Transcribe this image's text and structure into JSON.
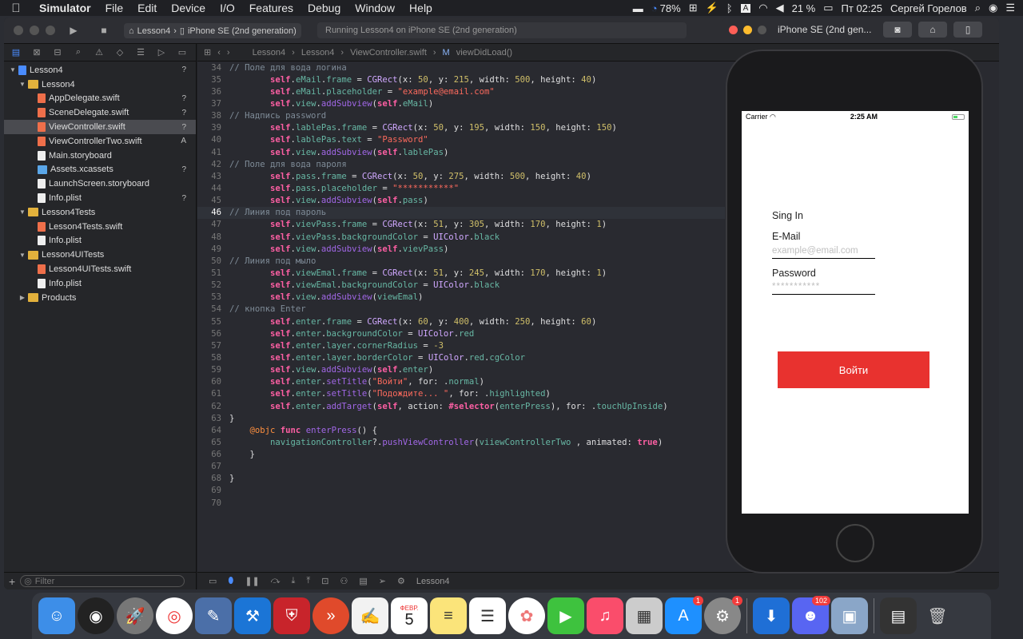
{
  "menubar": {
    "apple": "",
    "items": [
      "Simulator",
      "File",
      "Edit",
      "Device",
      "I/O",
      "Features",
      "Debug",
      "Window",
      "Help"
    ],
    "battery_pct": "78%",
    "volume_pct": "21 %",
    "clock": "Пт 02:25",
    "user": "Сергей Горелов"
  },
  "toolbar": {
    "scheme_project": "Lesson4",
    "scheme_device": "iPhone SE (2nd generation)",
    "status": "Running Lesson4 on iPhone SE (2nd generation)"
  },
  "navigator": {
    "filter_placeholder": "Filter",
    "rows": [
      {
        "label": "Lesson4",
        "kind": "proj",
        "depth": 0,
        "tri": "▼",
        "badge": "?"
      },
      {
        "label": "Lesson4",
        "kind": "folder",
        "depth": 1,
        "tri": "▼",
        "badge": ""
      },
      {
        "label": "AppDelegate.swift",
        "kind": "swift",
        "depth": 2,
        "tri": "",
        "badge": "?"
      },
      {
        "label": "SceneDelegate.swift",
        "kind": "swift",
        "depth": 2,
        "tri": "",
        "badge": "?"
      },
      {
        "label": "ViewController.swift",
        "kind": "swift",
        "depth": 2,
        "tri": "",
        "badge": "?",
        "selected": true
      },
      {
        "label": "ViewControllerTwo.swift",
        "kind": "swift",
        "depth": 2,
        "tri": "",
        "badge": "A"
      },
      {
        "label": "Main.storyboard",
        "kind": "file",
        "depth": 2,
        "tri": "",
        "badge": ""
      },
      {
        "label": "Assets.xcassets",
        "kind": "assets",
        "depth": 2,
        "tri": "",
        "badge": "?"
      },
      {
        "label": "LaunchScreen.storyboard",
        "kind": "file",
        "depth": 2,
        "tri": "",
        "badge": ""
      },
      {
        "label": "Info.plist",
        "kind": "file",
        "depth": 2,
        "tri": "",
        "badge": "?"
      },
      {
        "label": "Lesson4Tests",
        "kind": "folder",
        "depth": 1,
        "tri": "▼",
        "badge": ""
      },
      {
        "label": "Lesson4Tests.swift",
        "kind": "swift",
        "depth": 2,
        "tri": "",
        "badge": ""
      },
      {
        "label": "Info.plist",
        "kind": "file",
        "depth": 2,
        "tri": "",
        "badge": ""
      },
      {
        "label": "Lesson4UITests",
        "kind": "folder",
        "depth": 1,
        "tri": "▼",
        "badge": ""
      },
      {
        "label": "Lesson4UITests.swift",
        "kind": "swift",
        "depth": 2,
        "tri": "",
        "badge": ""
      },
      {
        "label": "Info.plist",
        "kind": "file",
        "depth": 2,
        "tri": "",
        "badge": ""
      },
      {
        "label": "Products",
        "kind": "folder",
        "depth": 1,
        "tri": "▶",
        "badge": ""
      }
    ]
  },
  "jumpbar": {
    "crumbs": [
      "Lesson4",
      "Lesson4",
      "ViewController.swift",
      "viewDidLoad()"
    ]
  },
  "code": {
    "current_line": 46,
    "lines": [
      {
        "n": 34,
        "html": "<span class='cm'>// Поле для вода логина</span>"
      },
      {
        "n": 35,
        "html": "        <span class='kw'>self</span>.<span class='pr'>eMail</span>.<span class='pr'>frame</span> = <span class='ty'>CGRect</span>(x: <span class='nm'>50</span>, y: <span class='nm'>215</span>, width: <span class='nm'>500</span>, height: <span class='nm'>40</span>)"
      },
      {
        "n": 36,
        "html": "        <span class='kw'>self</span>.<span class='pr'>eMail</span>.<span class='pr'>placeholder</span> = <span class='st'>\"example@email.com\"</span>"
      },
      {
        "n": 37,
        "html": "        <span class='kw'>self</span>.<span class='pr'>view</span>.<span class='fn'>addSubview</span>(<span class='kw'>self</span>.<span class='pr'>eMail</span>)"
      },
      {
        "n": 38,
        "html": "<span class='cm'>// Надпись password</span>"
      },
      {
        "n": 39,
        "html": "        <span class='kw'>self</span>.<span class='pr'>lablePas</span>.<span class='pr'>frame</span> = <span class='ty'>CGRect</span>(x: <span class='nm'>50</span>, y: <span class='nm'>195</span>, width: <span class='nm'>150</span>, height: <span class='nm'>150</span>)"
      },
      {
        "n": 40,
        "html": "        <span class='kw'>self</span>.<span class='pr'>lablePas</span>.<span class='pr'>text</span> = <span class='st'>\"Password\"</span>"
      },
      {
        "n": 41,
        "html": "        <span class='kw'>self</span>.<span class='pr'>view</span>.<span class='fn'>addSubview</span>(<span class='kw'>self</span>.<span class='pr'>lablePas</span>)"
      },
      {
        "n": 42,
        "html": "<span class='cm'>// Поле для вода пароля</span>"
      },
      {
        "n": 43,
        "html": "        <span class='kw'>self</span>.<span class='pr'>pass</span>.<span class='pr'>frame</span> = <span class='ty'>CGRect</span>(x: <span class='nm'>50</span>, y: <span class='nm'>275</span>, width: <span class='nm'>500</span>, height: <span class='nm'>40</span>)"
      },
      {
        "n": 44,
        "html": "        <span class='kw'>self</span>.<span class='pr'>pass</span>.<span class='pr'>placeholder</span> = <span class='st'>\"***********\"</span>"
      },
      {
        "n": 45,
        "html": "        <span class='kw'>self</span>.<span class='pr'>view</span>.<span class='fn'>addSubview</span>(<span class='kw'>self</span>.<span class='pr'>pass</span>)"
      },
      {
        "n": 46,
        "html": "<span class='cm'>// Линия под пароль</span>"
      },
      {
        "n": 47,
        "html": "        <span class='kw'>self</span>.<span class='pr'>vievPass</span>.<span class='pr'>frame</span> = <span class='ty'>CGRect</span>(x: <span class='nm'>51</span>, y: <span class='nm'>305</span>, width: <span class='nm'>170</span>, height: <span class='nm'>1</span>)"
      },
      {
        "n": 48,
        "html": "        <span class='kw'>self</span>.<span class='pr'>vievPass</span>.<span class='pr'>backgroundColor</span> = <span class='ty'>UIColor</span>.<span class='pr'>black</span>"
      },
      {
        "n": 49,
        "html": "        <span class='kw'>self</span>.<span class='pr'>view</span>.<span class='fn'>addSubview</span>(<span class='kw'>self</span>.<span class='pr'>vievPass</span>)"
      },
      {
        "n": 50,
        "html": "<span class='cm'>// Линия под мыло</span>"
      },
      {
        "n": 51,
        "html": "        <span class='kw'>self</span>.<span class='pr'>viewEmal</span>.<span class='pr'>frame</span> = <span class='ty'>CGRect</span>(x: <span class='nm'>51</span>, y: <span class='nm'>245</span>, width: <span class='nm'>170</span>, height: <span class='nm'>1</span>)"
      },
      {
        "n": 52,
        "html": "        <span class='kw'>self</span>.<span class='pr'>viewEmal</span>.<span class='pr'>backgroundColor</span> = <span class='ty'>UIColor</span>.<span class='pr'>black</span>"
      },
      {
        "n": 53,
        "html": "        <span class='kw'>self</span>.<span class='pr'>view</span>.<span class='fn'>addSubview</span>(<span class='pr'>viewEmal</span>)"
      },
      {
        "n": 54,
        "html": "<span class='cm'>// кнопка Enter</span>"
      },
      {
        "n": 55,
        "html": "        <span class='kw'>self</span>.<span class='pr'>enter</span>.<span class='pr'>frame</span> = <span class='ty'>CGRect</span>(x: <span class='nm'>60</span>, y: <span class='nm'>400</span>, width: <span class='nm'>250</span>, height: <span class='nm'>60</span>)"
      },
      {
        "n": 56,
        "html": "        <span class='kw'>self</span>.<span class='pr'>enter</span>.<span class='pr'>backgroundColor</span> = <span class='ty'>UIColor</span>.<span class='pr'>red</span>"
      },
      {
        "n": 57,
        "html": "        <span class='kw'>self</span>.<span class='pr'>enter</span>.<span class='pr'>layer</span>.<span class='pr'>cornerRadius</span> = <span class='nm'>-3</span>"
      },
      {
        "n": 58,
        "html": "        <span class='kw'>self</span>.<span class='pr'>enter</span>.<span class='pr'>layer</span>.<span class='pr'>borderColor</span> = <span class='ty'>UIColor</span>.<span class='pr'>red</span>.<span class='pr'>cgColor</span>"
      },
      {
        "n": 59,
        "html": "        <span class='kw'>self</span>.<span class='pr'>view</span>.<span class='fn'>addSubview</span>(<span class='kw'>self</span>.<span class='pr'>enter</span>)"
      },
      {
        "n": 60,
        "html": "        <span class='kw'>self</span>.<span class='pr'>enter</span>.<span class='fn'>setTitle</span>(<span class='st'>\"Войти\"</span>, for: .<span class='pr'>normal</span>)"
      },
      {
        "n": 61,
        "html": "        <span class='kw'>self</span>.<span class='pr'>enter</span>.<span class='fn'>setTitle</span>(<span class='st'>\"Подождите... \"</span>, for: .<span class='pr'>highlighted</span>)"
      },
      {
        "n": 62,
        "html": "        <span class='kw'>self</span>.<span class='pr'>enter</span>.<span class='fn'>addTarget</span>(<span class='kw'>self</span>, action: <span class='kw'>#selector</span>(<span class='pr'>enterPress</span>), for: .<span class='pr'>touchUpInside</span>)"
      },
      {
        "n": 63,
        "html": "}"
      },
      {
        "n": 64,
        "html": "    <span class='attr'>@objc</span> <span class='kw'>func</span> <span class='fn'>enterPress</span>() {"
      },
      {
        "n": 65,
        "html": "        <span class='pr'>navigationController</span>?.<span class='fn'>pushViewController</span>(<span class='pr'>viiewControllerTwo</span> , animated: <span class='kw'>true</span>)"
      },
      {
        "n": 66,
        "html": "    }"
      },
      {
        "n": 67,
        "html": ""
      },
      {
        "n": 68,
        "html": "}"
      },
      {
        "n": 69,
        "html": ""
      },
      {
        "n": 70,
        "html": ""
      }
    ]
  },
  "editor_bottom": {
    "target": "Lesson4"
  },
  "simulator": {
    "title": "iPhone SE (2nd gen...",
    "carrier": "Carrier",
    "time": "2:25 AM",
    "sign_in": "Sing In",
    "email_label": "E-Mail",
    "email_placeholder": "example@email.com",
    "password_label": "Password",
    "password_placeholder": "***********",
    "enter_button": "Войти"
  },
  "dock": {
    "badges": {
      "appstore": "1",
      "prefs": "1",
      "discord": "102"
    },
    "calendar_month": "ФЕВР.",
    "calendar_day": "5"
  },
  "colors": {
    "enter_button": "#e8322f",
    "accent": "#4a8cff"
  }
}
